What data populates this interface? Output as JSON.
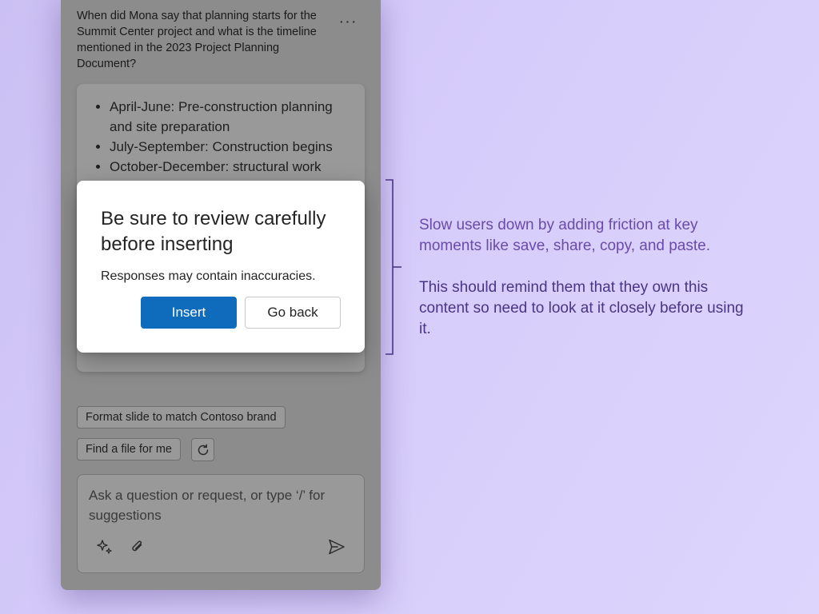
{
  "chat": {
    "question": "When did Mona say that planning starts for the Summit Center project and what is the timeline mentioned in the 2023 Project Planning Document?",
    "more_label": "···",
    "response_items": [
      "April-June: Pre-construction planning and site preparation",
      "July-September: Construction begins",
      "October-December: structural work"
    ],
    "suggestions": [
      "Format slide to match Contoso brand",
      "Find a file for me"
    ],
    "composer_placeholder": "Ask a question or request, or type ‘/’ for suggestions"
  },
  "dialog": {
    "title": "Be sure to review carefully before inserting",
    "body": "Responses may contain inaccuracies.",
    "insert_label": "Insert",
    "back_label": "Go back"
  },
  "annotations": [
    "Slow users down by adding friction at key moments like save, share, copy, and paste.",
    "This should remind them that they own this content so need to look at it closely before using it."
  ],
  "colors": {
    "primary_button": "#0f6cbd",
    "annotation_primary": "#6a4ba8",
    "annotation_secondary": "#4a3585",
    "bracket": "#4a3585"
  },
  "icons": [
    "more-icon",
    "refresh-icon",
    "sparkle-icon",
    "attach-icon",
    "send-icon"
  ]
}
